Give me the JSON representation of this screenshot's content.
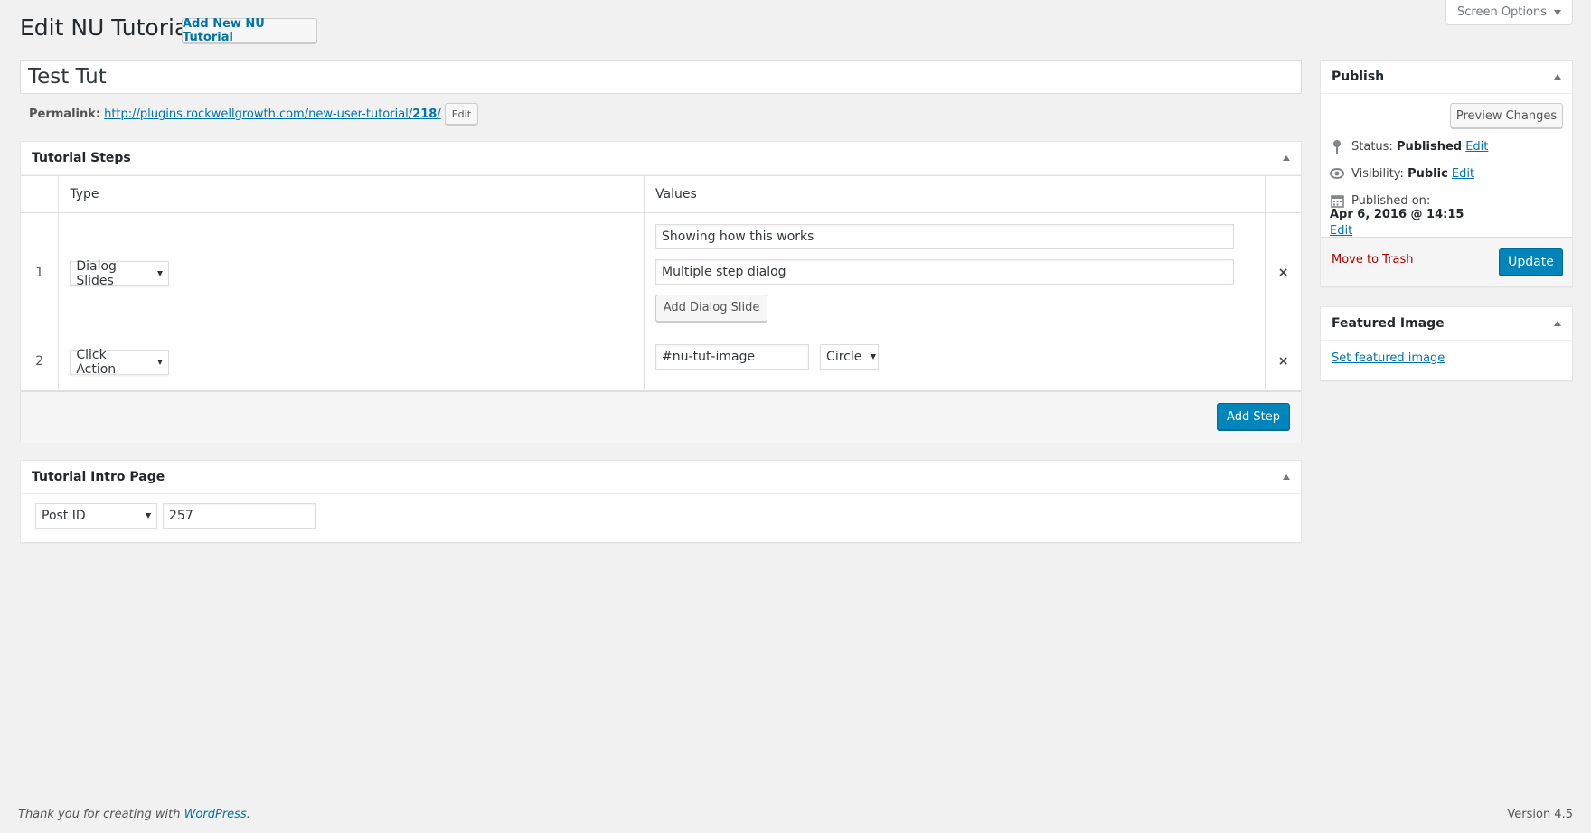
{
  "header": {
    "title": "Edit NU Tutorial",
    "add_new_label": "Add New NU Tutorial",
    "screen_options_label": "Screen Options"
  },
  "post": {
    "title_value": "Test Tut",
    "permalink_label": "Permalink:",
    "permalink_base": "http://plugins.rockwellgrowth.com/new-user-tutorial/",
    "permalink_slug": "218",
    "permalink_end": "/",
    "permalink_edit_label": "Edit"
  },
  "tutorial_steps": {
    "title": "Tutorial Steps",
    "columns": {
      "type": "Type",
      "values": "Values"
    },
    "rows": [
      {
        "num": "1",
        "type": "Dialog Slides",
        "values": [
          "Showing how this works",
          "Multiple step dialog"
        ],
        "add_slide_label": "Add Dialog Slide",
        "delete_icon": "×"
      },
      {
        "num": "2",
        "type": "Click Action",
        "selector": "#nu-tut-image",
        "shape": "Circle",
        "delete_icon": "×"
      }
    ],
    "add_step_label": "Add Step"
  },
  "intro_page": {
    "title": "Tutorial Intro Page",
    "select_value": "Post ID",
    "input_value": "257"
  },
  "publish": {
    "title": "Publish",
    "preview_label": "Preview Changes",
    "status_label": "Status:",
    "status_value": "Published",
    "visibility_label": "Visibility:",
    "visibility_value": "Public",
    "published_on_label": "Published on:",
    "published_on_value": "Apr 6, 2016 @ 14:15",
    "edit_label": "Edit",
    "trash_label": "Move to Trash",
    "update_label": "Update"
  },
  "featured_image": {
    "title": "Featured Image",
    "set_label": "Set featured image"
  },
  "footer": {
    "thanks_prefix": "Thank you for creating with ",
    "wordpress_link": "WordPress",
    "thanks_suffix": ".",
    "version": "Version 4.5"
  },
  "colors": {
    "primary": "#0085ba",
    "link": "#0073aa",
    "trash": "#a00",
    "background": "#f1f1f1"
  }
}
